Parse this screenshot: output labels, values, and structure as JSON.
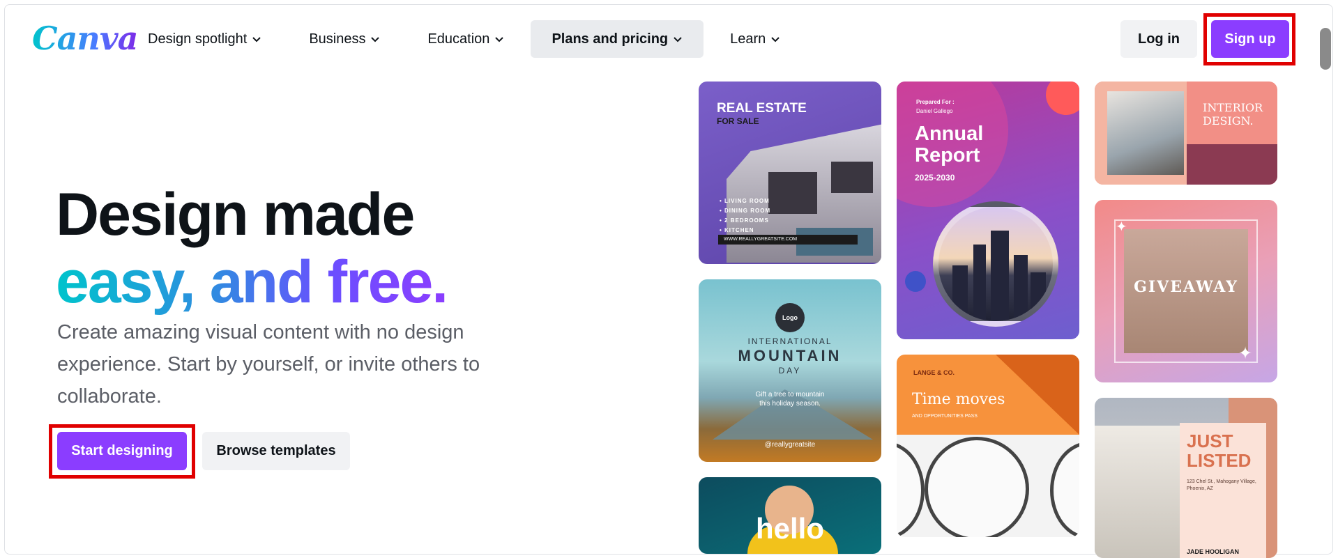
{
  "brand": {
    "logo": "Canva"
  },
  "nav": {
    "items": [
      {
        "label": "Design spotlight"
      },
      {
        "label": "Business"
      },
      {
        "label": "Education"
      },
      {
        "label": "Plans and pricing"
      },
      {
        "label": "Learn"
      }
    ],
    "login": "Log in",
    "signup": "Sign up"
  },
  "hero": {
    "headline_line1": "Design made",
    "headline_line2": "easy, and free.",
    "subtitle": "Create amazing visual content with no design experience. Start by yourself, or invite others to collaborate.",
    "start_button": "Start designing",
    "browse_button": "Browse templates"
  },
  "templates": {
    "realestate": {
      "title": "REAL ESTATE",
      "subtitle": "FOR SALE",
      "list": [
        "• LIVING ROOM",
        "• DINING ROOM",
        "• 2 BEDROOMS",
        "• KITCHEN"
      ],
      "url": "WWW.REALLYGREATSITE.COM"
    },
    "annual": {
      "prepared": "Prepared For :",
      "name": "Daniel Gallego",
      "title1": "Annual",
      "title2": "Report",
      "years": "2025-2030"
    },
    "interior": {
      "title1": "INTERIOR",
      "title2": "DESIGN."
    },
    "mountain": {
      "logo": "Logo",
      "line1": "INTERNATIONAL",
      "line2": "MOUNTAIN",
      "line3": "DAY",
      "tag1": "Gift a tree to mountain",
      "tag2": "this holiday season.",
      "handle": "@reallygreatsite"
    },
    "time": {
      "brand": "LANGE & CO.",
      "title": "Time moves",
      "sub": "AND OPPORTUNITIES PASS"
    },
    "giveaway": {
      "title": "GIVEAWAY"
    },
    "hello": {
      "title": "hello"
    },
    "listed": {
      "title1": "JUST",
      "title2": "LISTED",
      "address": "123 Chel St., Mahogany Village, Phoenix, AZ",
      "agent": "JADE HOOLIGAN"
    }
  },
  "colors": {
    "accent": "#8b3dff",
    "highlight": "#e00000"
  }
}
